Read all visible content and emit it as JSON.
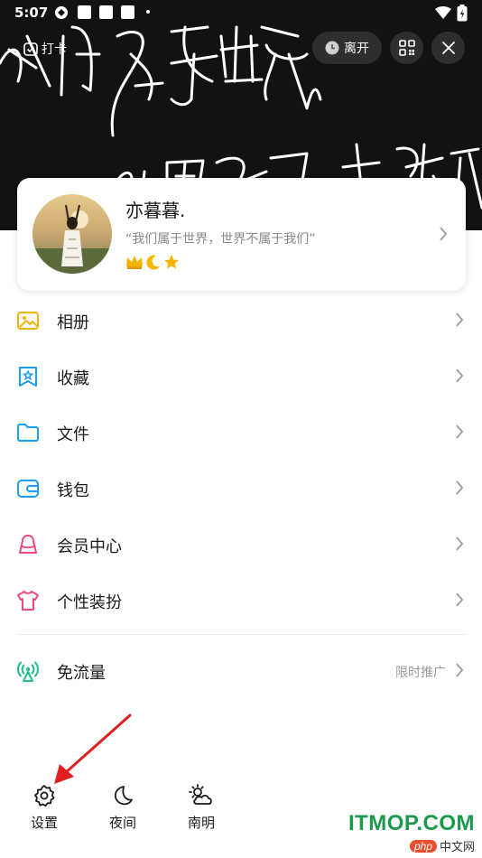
{
  "status_bar": {
    "time": "5:07"
  },
  "header": {
    "checkin_label": "打卡",
    "leave_label": "离开",
    "background_text": "我们属于世界 世界不属于我们"
  },
  "profile": {
    "nickname": "亦暮暮.",
    "signature": "“我们属于世界，世界不属于我们”",
    "badges": [
      "crown-badge",
      "moon-badge",
      "star-badge"
    ]
  },
  "menu": {
    "items": [
      {
        "label": "相册",
        "icon": "photo-album-icon",
        "color": "#f5b400"
      },
      {
        "label": "收藏",
        "icon": "favorite-icon",
        "color": "#1aa0f0"
      },
      {
        "label": "文件",
        "icon": "folder-icon",
        "color": "#1aa0f0"
      },
      {
        "label": "钱包",
        "icon": "wallet-icon",
        "color": "#1aa0f0"
      },
      {
        "label": "会员中心",
        "icon": "vip-icon",
        "color": "#f04a78"
      },
      {
        "label": "个性装扮",
        "icon": "outfit-icon",
        "color": "#f04a78"
      }
    ],
    "free_data": {
      "label": "免流量",
      "hint": "限时推广",
      "icon": "signal-icon",
      "color": "#1dbf8c"
    }
  },
  "bottom": {
    "settings_label": "设置",
    "night_label": "夜间",
    "weather_label": "南明"
  },
  "watermark": {
    "text": "ITMOP.COM",
    "php_text": "php",
    "site_text": "中文网"
  },
  "colors": {
    "accent_blue": "#1aa0f0",
    "arrow_red": "#e02020"
  }
}
